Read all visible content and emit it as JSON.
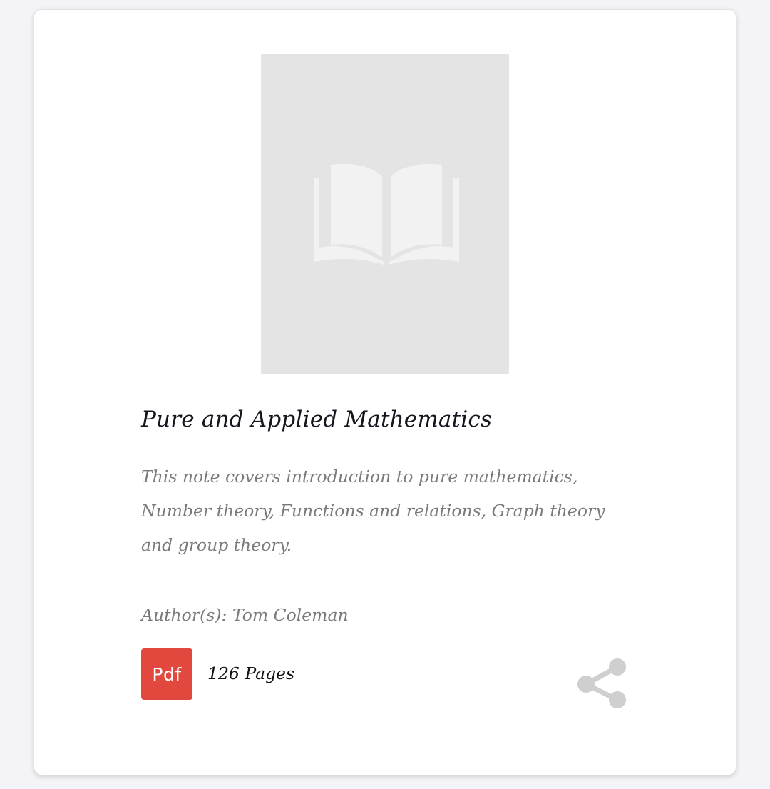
{
  "book": {
    "title": "Pure and Applied Mathematics",
    "description": "This note covers introduction to pure mathematics, Number theory, Functions and relations, Graph theory and group theory.",
    "author": "Author(s): Tom Coleman",
    "format_badge": "Pdf",
    "pages": "126 Pages"
  },
  "icons": {
    "cover_placeholder": "open-book-icon",
    "share": "share-icon"
  },
  "colors": {
    "pdf_badge": "#e2483d",
    "cover_placeholder": "#e4e4e4",
    "share_icon": "#cfcfcf"
  }
}
